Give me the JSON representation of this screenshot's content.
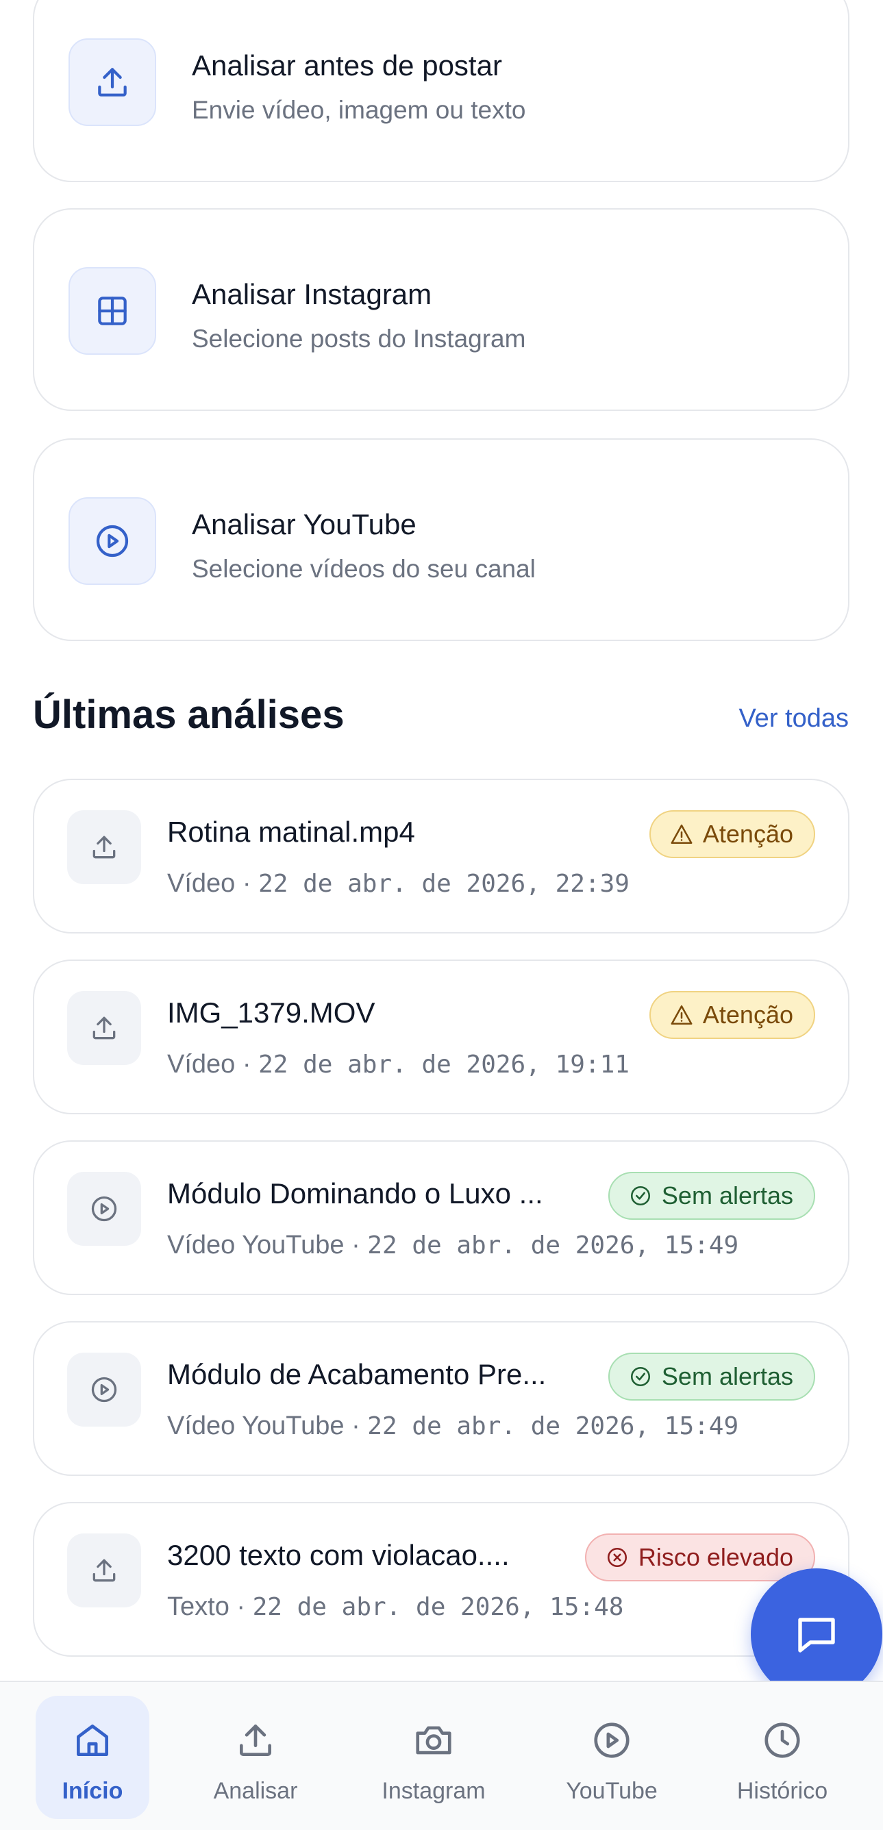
{
  "actions": [
    {
      "title": "Analisar antes de postar",
      "subtitle": "Envie vídeo, imagem ou texto",
      "icon": "upload-icon"
    },
    {
      "title": "Analisar Instagram",
      "subtitle": "Selecione posts do Instagram",
      "icon": "grid-icon"
    },
    {
      "title": "Analisar YouTube",
      "subtitle": "Selecione vídeos do seu canal",
      "icon": "play-circle-icon"
    }
  ],
  "recent": {
    "title": "Últimas análises",
    "see_all": "Ver todas",
    "items": [
      {
        "name": "Rotina matinal.mp4",
        "type": "Vídeo",
        "date": "22 de abr. de 2026, 22:39",
        "badge": "Atenção",
        "status": "warning",
        "icon": "upload-icon"
      },
      {
        "name": "IMG_1379.MOV",
        "type": "Vídeo",
        "date": "22 de abr. de 2026, 19:11",
        "badge": "Atenção",
        "status": "warning",
        "icon": "upload-icon"
      },
      {
        "name": "Módulo Dominando o Luxo ...",
        "type": "Vídeo YouTube",
        "date": "22 de abr. de 2026, 15:49",
        "badge": "Sem alertas",
        "status": "ok",
        "icon": "play-circle-icon"
      },
      {
        "name": "Módulo de Acabamento Pre...",
        "type": "Vídeo YouTube",
        "date": "22 de abr. de 2026, 15:49",
        "badge": "Sem alertas",
        "status": "ok",
        "icon": "play-circle-icon"
      },
      {
        "name": "3200 texto com violacao....",
        "type": "Texto",
        "date": "22 de abr. de 2026, 15:48",
        "badge": "Risco elevado",
        "status": "risk",
        "icon": "upload-icon"
      }
    ]
  },
  "separator": "·",
  "nav": [
    {
      "label": "Início",
      "icon": "home-icon",
      "active": true
    },
    {
      "label": "Analisar",
      "icon": "upload-icon",
      "active": false
    },
    {
      "label": "Instagram",
      "icon": "camera-icon",
      "active": false
    },
    {
      "label": "YouTube",
      "icon": "play-circle-icon",
      "active": false
    },
    {
      "label": "Histórico",
      "icon": "clock-icon",
      "active": false
    }
  ],
  "colors": {
    "accent": "#3461c9",
    "fab": "#3b63e0",
    "warning_bg": "#fdf1c7",
    "ok_bg": "#e0f5e4",
    "risk_bg": "#fbe3e3"
  }
}
